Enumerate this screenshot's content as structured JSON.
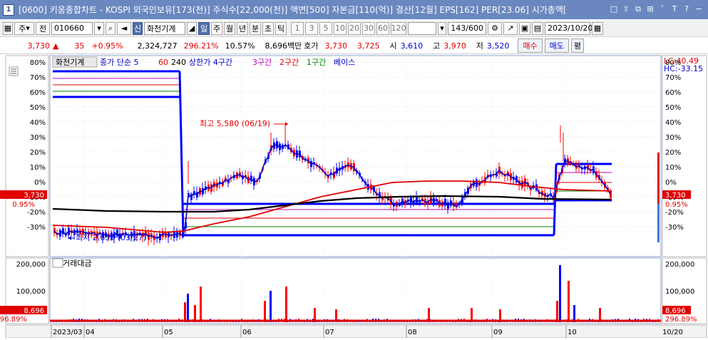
{
  "title": {
    "number": "1",
    "text": "[0600] 키움종합차트 - KOSPI 외국인보유[173(천)] 주식수[22,000(천)] 액면[500] 자본금[110(억)] 결산[12월] EPS[162] PER[23.06] 시가총액[",
    "icons": [
      "□",
      "⇧",
      "⧉",
      "⊞",
      "ʹ",
      "T",
      "?",
      "−"
    ]
  },
  "toolbar": {
    "market": "주",
    "all_label": "전",
    "code": "010660",
    "sound": "◄",
    "new_label": "신",
    "stock_name": "화천기계",
    "periods": [
      "일",
      "주",
      "월",
      "년",
      "분",
      "초",
      "틱"
    ],
    "active_period": "일",
    "minutes": [
      "1",
      "3",
      "5",
      "10",
      "20",
      "30",
      "60",
      "120"
    ],
    "count": "143",
    "count_max": "/600",
    "date": "2023/10/20"
  },
  "quote": {
    "price": "3,730",
    "arrow": "▲",
    "change": "35",
    "change_pct": "+0.95%",
    "volume": "2,324,727",
    "vol_ratio": "296.21%",
    "turnover": "10.57%",
    "amount": "8,696백만",
    "hoga_label": "호가",
    "ask": "3,730",
    "bid": "3,725",
    "open_label": "시",
    "open": "3,610",
    "high_label": "고",
    "high": "3,970",
    "low_label": "저",
    "low": "3,520",
    "buy": "매수",
    "sell": "매도",
    "eval": "평"
  },
  "chart": {
    "legend_name": "화천기계",
    "legend_ma": "종가 단순 5",
    "legend_60": "60",
    "legend_240": "240",
    "legend_upper": "상한가 4구간",
    "legend_3": "3구간",
    "legend_2": "2구간",
    "legend_1": "1구간",
    "legend_base": "베이스",
    "lc": "LC:40.49",
    "hc": "HC:-33.15",
    "price_badge": "3,730",
    "pct_badge": "0.95%",
    "high_note": "최고 5,580 (06/19)",
    "low_note": "최저 2,655 (03/27)",
    "y_pct": [
      "80%",
      "70%",
      "60%",
      "50%",
      "40%",
      "30%",
      "20%",
      "10%",
      "0%",
      "-10%",
      "-20%",
      "-30%"
    ],
    "volume_title": "거래대금",
    "vol_ticks": [
      "200,000",
      "100,000"
    ],
    "vol_badge": "8,696",
    "vol_pct": "296.89%",
    "x_labels": [
      "2023/03",
      "04",
      "05",
      "06",
      "07",
      "08",
      "09",
      "10"
    ],
    "x_right": "10/20"
  },
  "colors": {
    "up": "#ff0000",
    "down": "#0000ff",
    "frame": "#6a88bf"
  }
}
